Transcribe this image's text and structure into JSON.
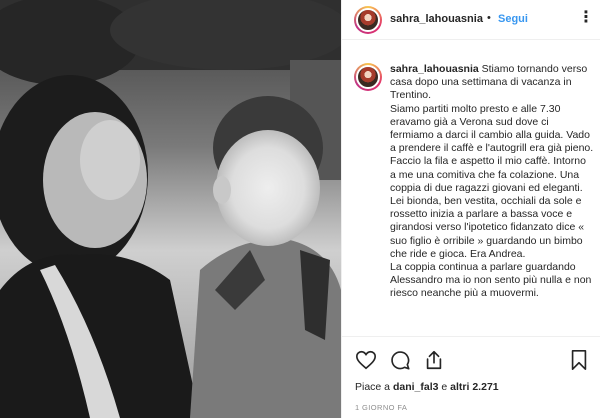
{
  "post": {
    "username": "sahra_lahouasnia",
    "separator": "•",
    "follow_label": "Segui",
    "more_label": "⋮"
  },
  "caption": {
    "username": "sahra_lahouasnia",
    "text": " Stiamo tornando verso casa dopo una settimana di vacanza in Trentino.\nSiamo partiti molto presto e alle 7.30 eravamo già a Verona sud dove ci fermiamo a darci il cambio alla guida. Vado a prendere il caffè e l'autogrill era già pieno. Faccio la fila e aspetto il mio caffè. Intorno a me una comitiva che fa colazione. Una coppia di due ragazzi giovani ed eleganti. Lei bionda, ben vestita, occhiali da sole e rossetto inizia a parlare a bassa voce e girandosi verso l'ipotetico fidanzato dice « suo figlio è orribile » guardando un bimbo che ride e gioca. Era Andrea.\nLa coppia continua a parlare guardando Alessandro ma io non sento più nulla e non riesco neanche più a muovermi."
  },
  "actions": {
    "like_icon": "heart-icon",
    "comment_icon": "comment-icon",
    "share_icon": "share-icon",
    "save_icon": "bookmark-icon"
  },
  "likes": {
    "prefix": "Piace a ",
    "user": "dani_fal3",
    "middle": " e ",
    "others": "altri 2.271"
  },
  "timestamp": "1 GIORNO FA"
}
